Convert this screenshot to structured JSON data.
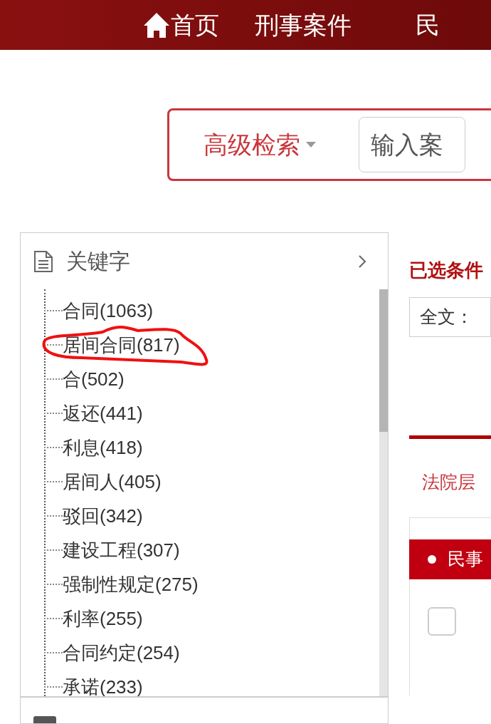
{
  "nav": [
    {
      "kind": "home",
      "label": "首页"
    },
    {
      "kind": "plain",
      "label": "刑事案件"
    },
    {
      "kind": "plain",
      "label": "民"
    }
  ],
  "search": {
    "mode": "高级检索",
    "placeholder": "输入案"
  },
  "keyword_panel": {
    "title": "关键字",
    "items": [
      {
        "label": "合同(1063)",
        "circled": false
      },
      {
        "label": "居间合同(817)",
        "circled": true
      },
      {
        "label": "合(502)",
        "circled": false
      },
      {
        "label": "返还(441)",
        "circled": false
      },
      {
        "label": "利息(418)",
        "circled": false
      },
      {
        "label": "居间人(405)",
        "circled": false
      },
      {
        "label": "驳回(342)",
        "circled": false
      },
      {
        "label": "建设工程(307)",
        "circled": false
      },
      {
        "label": "强制性规定(275)",
        "circled": false
      },
      {
        "label": "利率(255)",
        "circled": false
      },
      {
        "label": "合同约定(254)",
        "circled": false
      },
      {
        "label": "承诺(233)",
        "circled": false
      }
    ]
  },
  "selected_conditions": {
    "title": "已选条件",
    "field": "全文："
  },
  "court_level": {
    "label": "法院层"
  },
  "case_tab": {
    "label": "民事"
  },
  "result": {
    "checked": false
  }
}
